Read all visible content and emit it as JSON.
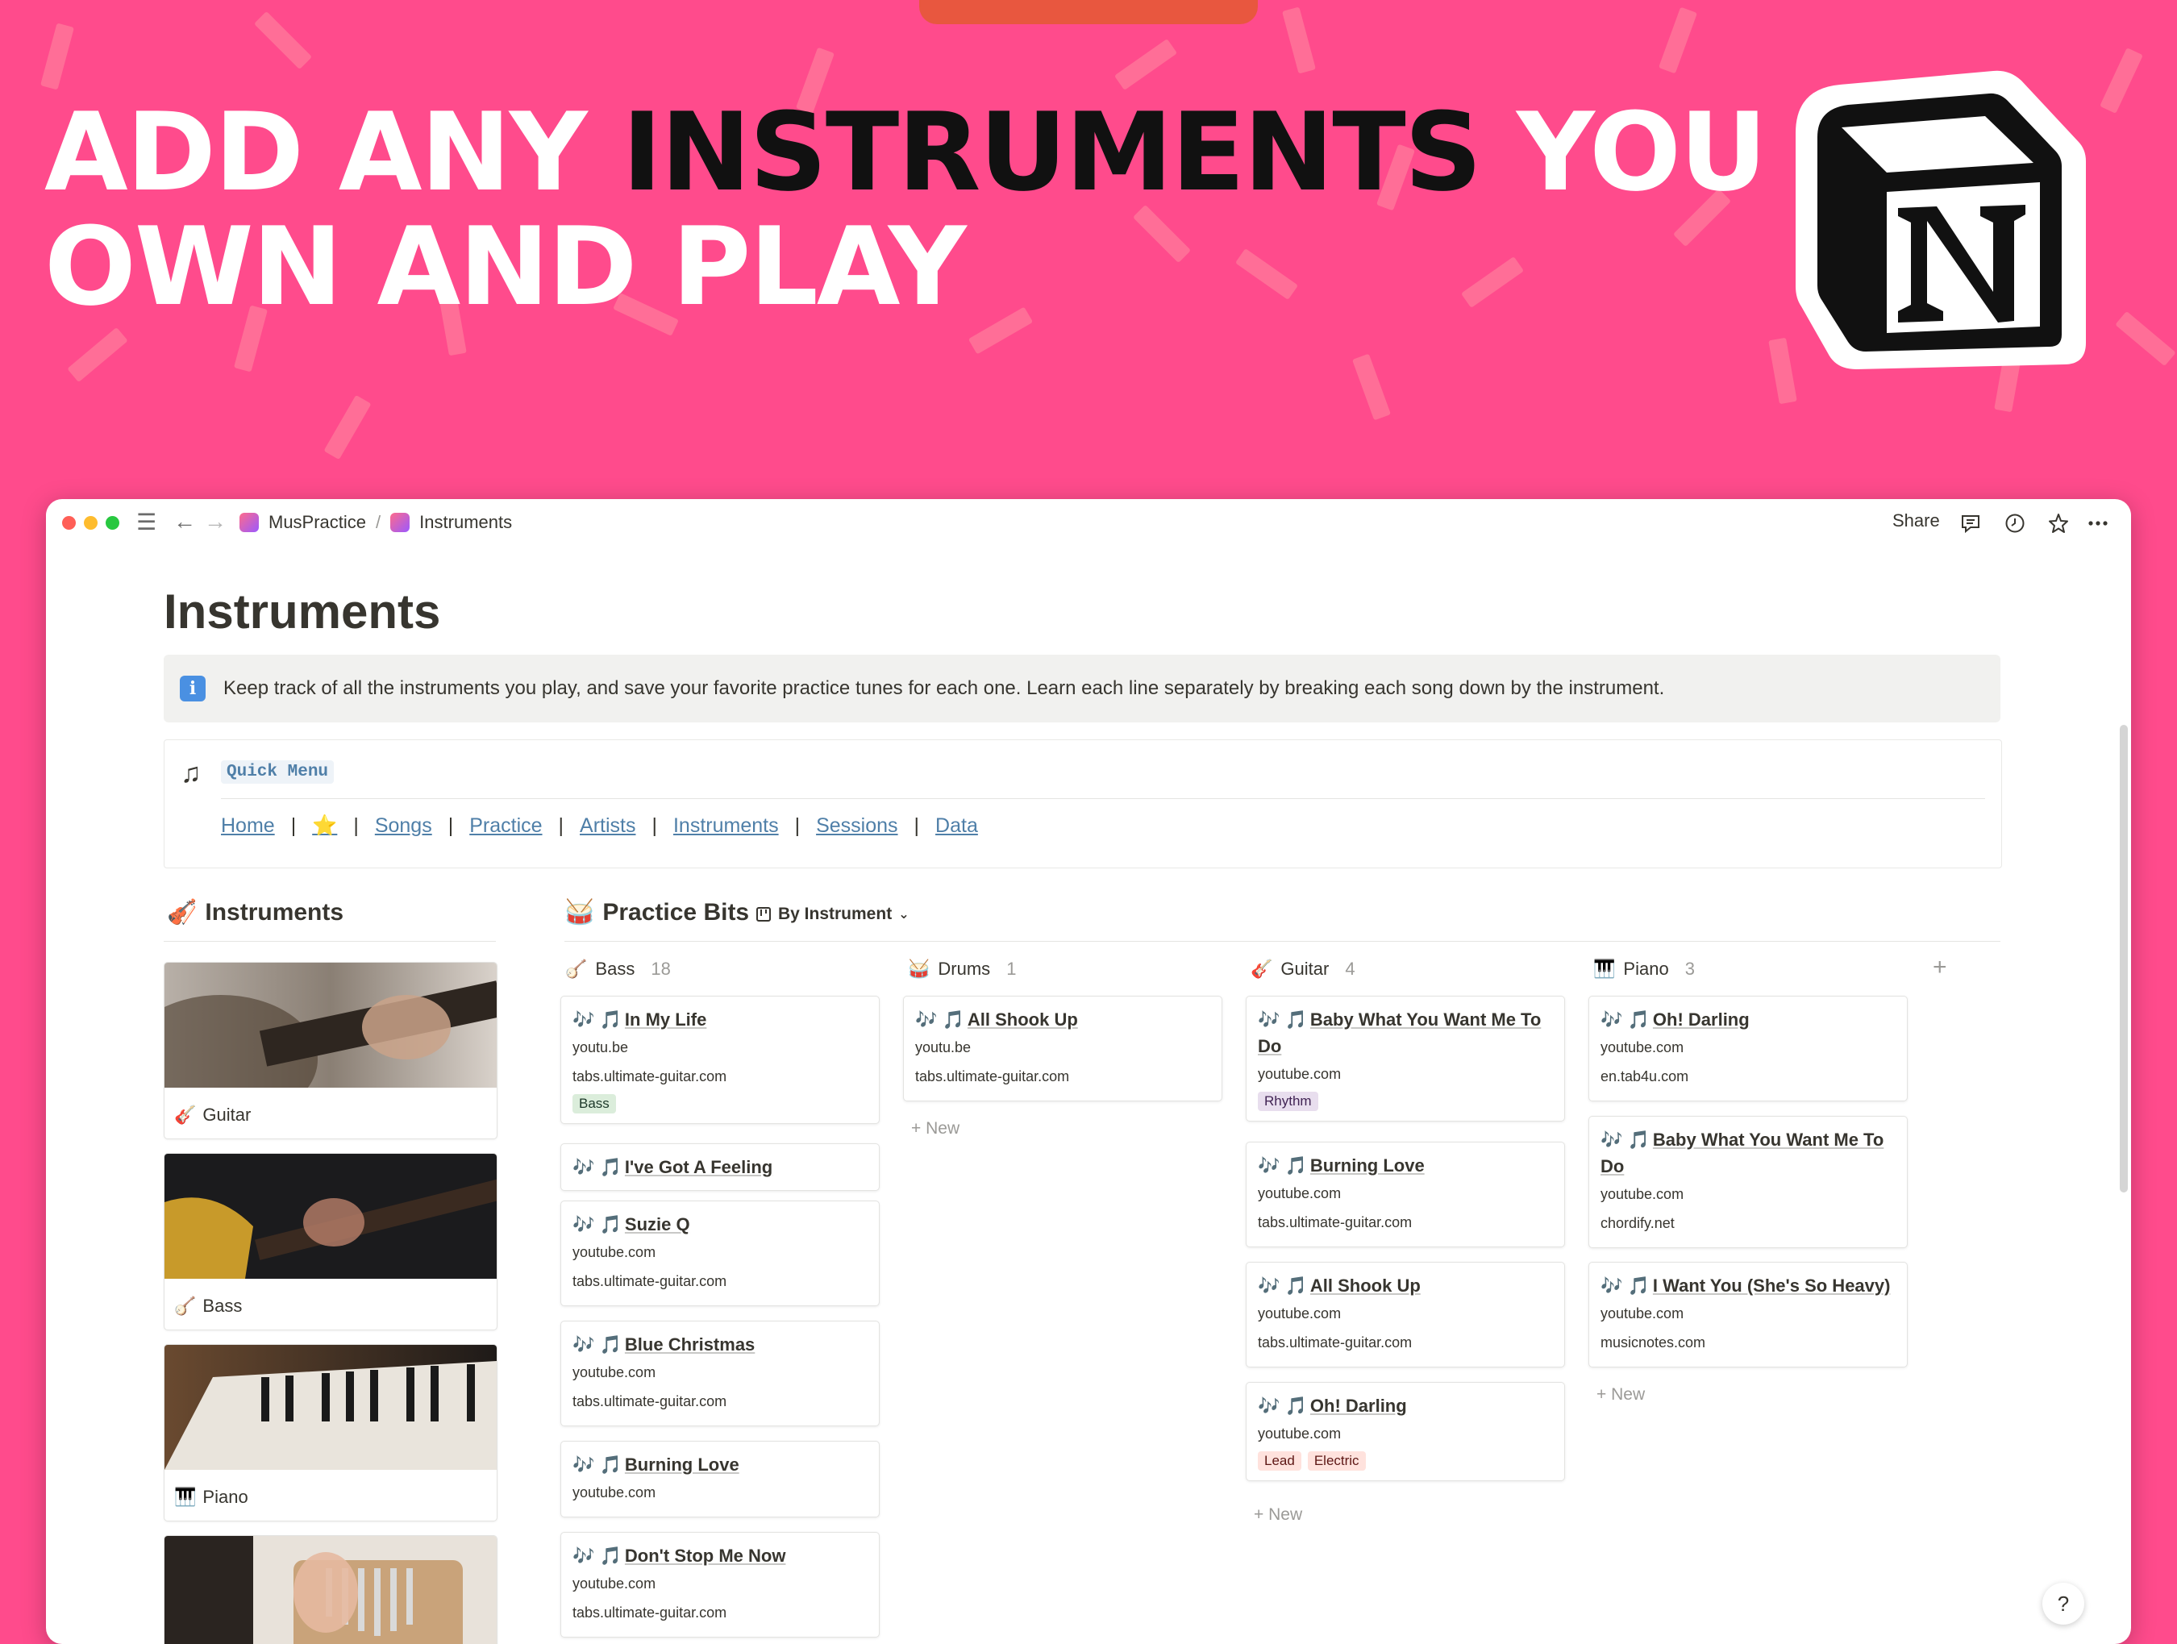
{
  "headline": {
    "part1": "ADD ANY ",
    "part2": "INSTRUMENTS",
    "part3": " YOU",
    "line2": "OWN AND PLAY"
  },
  "colors": {
    "background": "#ff4b8c",
    "accent_dark": "#111111",
    "link": "#4f7fa8"
  },
  "window": {
    "breadcrumb": [
      "MusPractice",
      "Instruments"
    ],
    "breadcrumb_sep": "/",
    "share_label": "Share",
    "icons": [
      "menu-icon",
      "back-arrow-icon",
      "forward-arrow-icon",
      "comment-icon",
      "clock-icon",
      "star-icon",
      "more-icon"
    ]
  },
  "page": {
    "title": "Instruments",
    "callout": "Keep track of all the instruments you play, and save your favorite practice tunes for each one. Learn each line separately by breaking each song down by the instrument.",
    "quick_menu": {
      "label": "Quick Menu",
      "links": [
        "Home",
        "⭐",
        "Songs",
        "Practice",
        "Artists",
        "Instruments",
        "Sessions",
        "Data"
      ],
      "sep": "|"
    }
  },
  "gallery": {
    "title": "Instruments",
    "items": [
      {
        "icon": "🎸",
        "name": "Guitar"
      },
      {
        "icon": "🪕",
        "name": "Bass"
      },
      {
        "icon": "🎹",
        "name": "Piano"
      },
      {
        "icon": "",
        "name": ""
      }
    ]
  },
  "board": {
    "title": "Practice Bits",
    "view": "By Instrument",
    "new_label": "New",
    "columns": [
      {
        "icon": "🪕",
        "name": "Bass",
        "count": "18",
        "cards": [
          {
            "title": "In My Life",
            "links": [
              "youtu.be",
              "tabs.ultimate-guitar.com"
            ],
            "tags": [
              "Bass"
            ]
          },
          {
            "title": "I've Got A Feeling",
            "links": [],
            "tags": []
          },
          {
            "title": "Suzie Q",
            "links": [
              "youtube.com",
              "tabs.ultimate-guitar.com"
            ],
            "tags": []
          },
          {
            "title": "Blue Christmas",
            "links": [
              "youtube.com",
              "tabs.ultimate-guitar.com"
            ],
            "tags": []
          },
          {
            "title": "Burning Love",
            "links": [
              "youtube.com"
            ],
            "tags": []
          },
          {
            "title": "Don't Stop Me Now",
            "links": [
              "youtube.com",
              "tabs.ultimate-guitar.com"
            ],
            "tags": []
          }
        ]
      },
      {
        "icon": "🥁",
        "name": "Drums",
        "count": "1",
        "cards": [
          {
            "title": "All Shook Up",
            "links": [
              "youtu.be",
              "tabs.ultimate-guitar.com"
            ],
            "tags": []
          }
        ]
      },
      {
        "icon": "🎸",
        "name": "Guitar",
        "count": "4",
        "cards": [
          {
            "title": "Baby What You Want Me To Do",
            "links": [
              "youtube.com"
            ],
            "tags": [
              "Rhythm"
            ]
          },
          {
            "title": "Burning Love",
            "links": [
              "youtube.com",
              "tabs.ultimate-guitar.com"
            ],
            "tags": []
          },
          {
            "title": "All Shook Up",
            "links": [
              "youtube.com",
              "tabs.ultimate-guitar.com"
            ],
            "tags": []
          },
          {
            "title": "Oh! Darling",
            "links": [
              "youtube.com"
            ],
            "tags": [
              "Lead",
              "Electric"
            ]
          }
        ]
      },
      {
        "icon": "🎹",
        "name": "Piano",
        "count": "3",
        "cards": [
          {
            "title": "Oh! Darling",
            "links": [
              "youtube.com",
              "en.tab4u.com"
            ],
            "tags": []
          },
          {
            "title": "Baby What You Want Me To Do",
            "links": [
              "youtube.com",
              "chordify.net"
            ],
            "tags": []
          },
          {
            "title": "I Want You (She's So Heavy)",
            "links": [
              "youtube.com",
              "musicnotes.com"
            ],
            "tags": []
          }
        ]
      }
    ]
  },
  "help_label": "?"
}
